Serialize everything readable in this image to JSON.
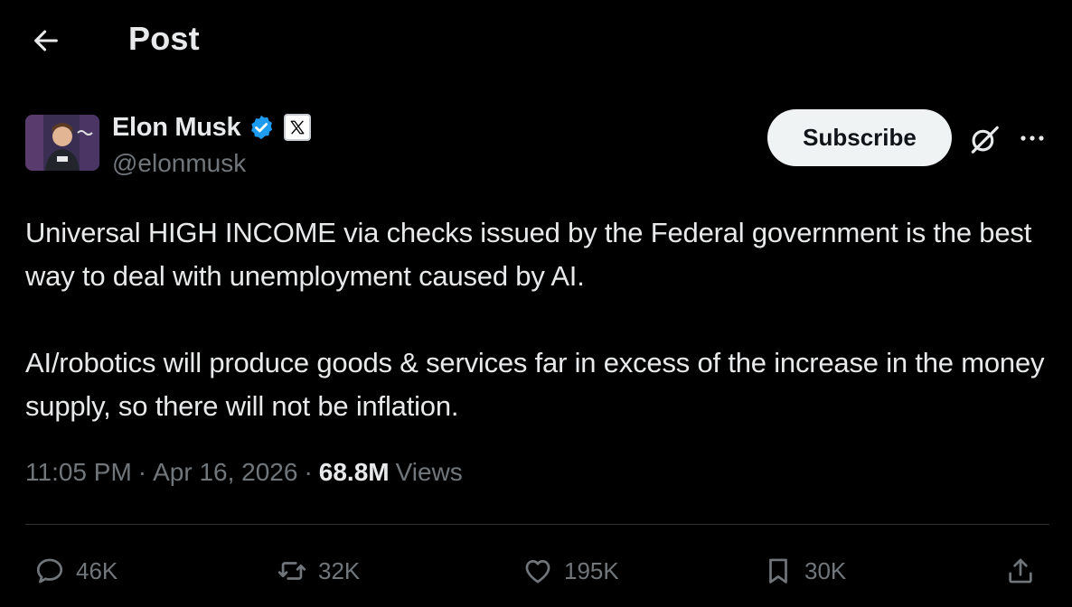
{
  "header": {
    "back_icon": "arrow-left-icon",
    "title": "Post"
  },
  "author": {
    "display_name": "Elon Musk",
    "handle": "@elonmusk",
    "verified_icon": "verified-badge-icon",
    "affiliation_icon": "x-logo-icon",
    "verified_color": "#1d9bf0"
  },
  "toolbar": {
    "subscribe_label": "Subscribe",
    "grok_icon": "grok-icon",
    "more_icon": "more-horizontal-icon"
  },
  "post": {
    "paragraphs": [
      "Universal HIGH INCOME via checks issued by the Federal government is the best way to deal with unemployment caused by AI.",
      "AI/robotics will produce goods & services far in excess of the increase in the money supply, so there will not be inflation."
    ],
    "time": "11:05 PM",
    "date": "Apr 16, 2026",
    "views_count": "68.8M",
    "views_label": "Views",
    "separator": "·"
  },
  "actions": {
    "replies": "46K",
    "reposts": "32K",
    "likes": "195K",
    "bookmarks": "30K",
    "icons": [
      "reply-icon",
      "repost-icon",
      "like-icon",
      "bookmark-icon",
      "share-icon"
    ]
  },
  "colors": {
    "background": "#000000",
    "text": "#e7e9ea",
    "secondary_text": "#71767b",
    "divider": "#2f3336",
    "button_bg": "#eff3f4"
  }
}
